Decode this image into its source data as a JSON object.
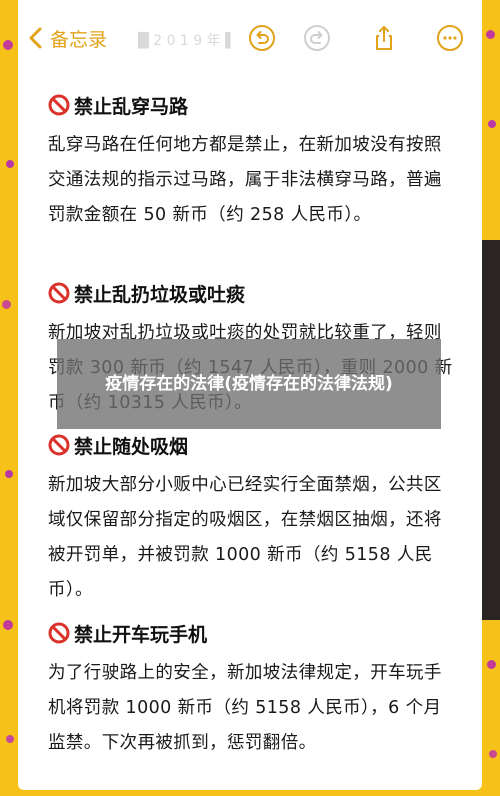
{
  "header": {
    "back_label": "备忘录",
    "faint_text": "█ 2 0 1 9 年 ▌"
  },
  "sections": [
    {
      "title": "禁止乱穿马路",
      "body": "乱穿马路在任何地方都是禁止，在新加坡没有按照交通法规的指示过马路，属于非法横穿马路，普遍罚款金额在 50 新币（约 258 人民币）。"
    },
    {
      "title": "禁止乱扔垃圾或吐痰",
      "body": "新加坡对乱扔垃圾或吐痰的处罚就比较重了，轻则罚款 300 新币（约 1547 人民币），重则 2000 新币（约 10315 人民币）。"
    },
    {
      "title": "禁止随处吸烟",
      "body": "新加坡大部分小贩中心已经实行全面禁烟，公共区域仅保留部分指定的吸烟区，在禁烟区抽烟，还将被开罚单，并被罚款 1000 新币（约 5158 人民币）。"
    },
    {
      "title": "禁止开车玩手机",
      "body": "为了行驶路上的安全，新加坡法律规定，开车玩手机将罚款 1000 新币（约 5158 人民币），6 个月监禁。下次再被抓到，惩罚翻倍。"
    }
  ],
  "banner": {
    "text": "疫情存在的法律(疫情存在的法律法规)"
  },
  "colors": {
    "background": "#f6c21a",
    "accent": "#e2a31a",
    "prohibited_red": "#d9332b",
    "banner_bg": "#707070"
  },
  "icons": [
    "back-chevron-icon",
    "undo-icon",
    "redo-icon",
    "share-icon",
    "more-icon",
    "prohibited-icon"
  ]
}
